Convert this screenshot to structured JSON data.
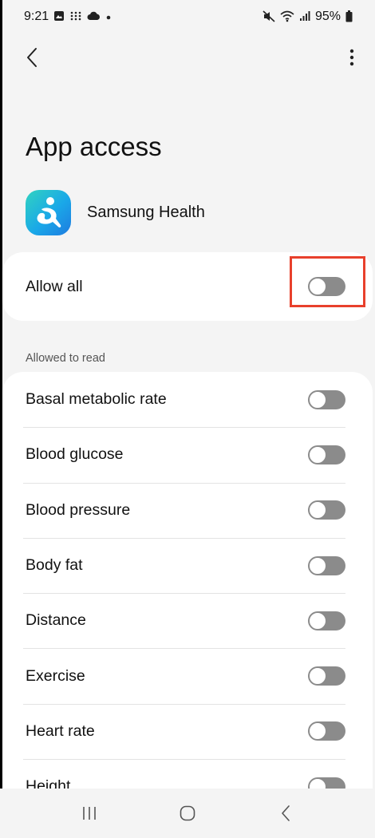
{
  "status_bar": {
    "time": "9:21",
    "battery": "95%",
    "left_icons": [
      "gallery-icon",
      "grid-dots-icon",
      "cloud-icon",
      "dot-icon"
    ],
    "right_icons": [
      "mute-icon",
      "wifi-icon",
      "signal-icon",
      "battery-icon"
    ]
  },
  "header": {
    "back_icon": "chevron-left-icon",
    "more_icon": "more-vertical-icon"
  },
  "page": {
    "title": "App access",
    "app_name": "Samsung Health",
    "app_icon": "samsung-health-icon"
  },
  "allow_all": {
    "label": "Allow all",
    "enabled": false
  },
  "allowed_to_read": {
    "section_label": "Allowed to read",
    "items": [
      {
        "label": "Basal metabolic rate",
        "enabled": false
      },
      {
        "label": "Blood glucose",
        "enabled": false
      },
      {
        "label": "Blood pressure",
        "enabled": false
      },
      {
        "label": "Body fat",
        "enabled": false
      },
      {
        "label": "Distance",
        "enabled": false
      },
      {
        "label": "Exercise",
        "enabled": false
      },
      {
        "label": "Heart rate",
        "enabled": false
      },
      {
        "label": "Height",
        "enabled": false
      }
    ]
  },
  "nav_bar": {
    "recents_icon": "recents-icon",
    "home_icon": "home-icon",
    "back_icon": "back-icon"
  },
  "colors": {
    "background": "#f4f4f4",
    "card": "#ffffff",
    "toggle_off": "#8b8b8b",
    "highlight": "#e8402c",
    "app_icon_gradient_start": "#31d3c0",
    "app_icon_gradient_end": "#1e7be0"
  }
}
